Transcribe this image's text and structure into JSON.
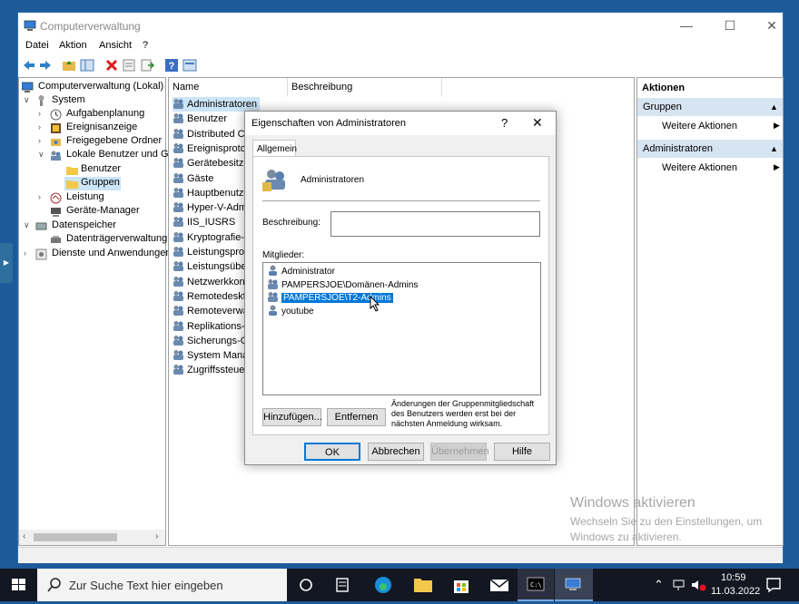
{
  "window": {
    "title": "Computerverwaltung",
    "minimize": "—",
    "maximize": "☐",
    "close": "✕"
  },
  "menu": [
    "Datei",
    "Aktion",
    "Ansicht",
    "?"
  ],
  "tree": {
    "root": "Computerverwaltung (Lokal)",
    "system": "System",
    "aufgabenplanung": "Aufgabenplanung",
    "ereignisanzeige": "Ereignisanzeige",
    "freigegebene": "Freigegebene Ordner",
    "lokale": "Lokale Benutzer und Gru",
    "benutzer": "Benutzer",
    "gruppen": "Gruppen",
    "leistung": "Leistung",
    "geraete": "Geräte-Manager",
    "datenspeicher": "Datenspeicher",
    "datentraeger": "Datenträgerverwaltung",
    "dienste": "Dienste und Anwendungen"
  },
  "list": {
    "col_name": "Name",
    "col_desc": "Beschreibung",
    "rows": [
      "Administratoren",
      "Benutzer",
      "Distributed CO",
      "Ereignisprotok",
      "Gerätebesitzer",
      "Gäste",
      "Hauptbenutze",
      "Hyper-V-Adm",
      "IIS_IUSRS",
      "Kryptografie-O",
      "Leistungsproto",
      "Leistungsüber",
      "Netzwerkkonfi",
      "Remotedesktop",
      "Remoteverwalt",
      "Replikations-O",
      "Sicherungs-Op",
      "System Manag",
      "Zugriffssteuer"
    ]
  },
  "actions": {
    "header": "Aktionen",
    "section1": "Gruppen",
    "more1": "Weitere Aktionen",
    "section2": "Administratoren",
    "more2": "Weitere Aktionen"
  },
  "dialog": {
    "title": "Eigenschaften von Administratoren",
    "help": "?",
    "close": "✕",
    "tab": "Allgemein",
    "group_name": "Administratoren",
    "desc_label": "Beschreibung:",
    "desc_value": "",
    "members_label": "Mitglieder:",
    "members": [
      "Administrator",
      "PAMPERSJOE\\Domänen-Admins",
      "PAMPERSJOE\\T2-Admins",
      "youtube"
    ],
    "add": "Hinzufügen...",
    "remove": "Entfernen",
    "note": "Änderungen der Gruppenmitgliedschaft des Benutzers werden erst bei der nächsten Anmeldung wirksam.",
    "ok": "OK",
    "cancel": "Abbrechen",
    "apply": "Übernehmen",
    "helpbtn": "Hilfe"
  },
  "watermark": {
    "line1": "Windows aktivieren",
    "line2": "Wechseln Sie zu den Einstellungen, um",
    "line3": "Windows zu aktivieren."
  },
  "taskbar": {
    "search_placeholder": "Zur Suche Text hier eingeben",
    "time": "10:59",
    "date": "11.03.2022"
  },
  "colors": {
    "accent": "#0078d7",
    "selection": "#cce4f7",
    "actions_section": "#d7e4f2",
    "taskbar": "#131722"
  }
}
